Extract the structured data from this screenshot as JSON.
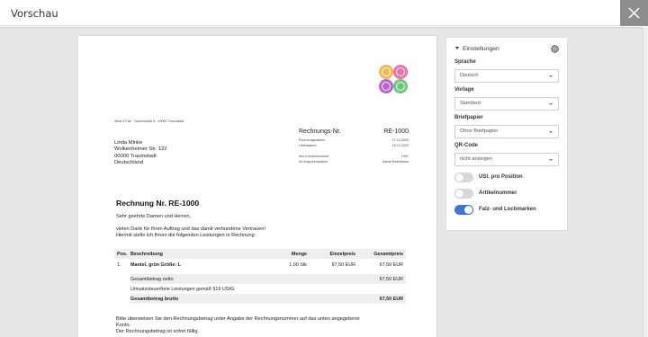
{
  "window": {
    "title": "Vorschau"
  },
  "invoice": {
    "sender_line": "Wear It Fair · Traumstraße 5 · 00000 Traumstadt",
    "recipient": [
      "Linda Minke",
      "Wolkenheimer Str. 122",
      "00000 Traumstadt",
      "Deutschland"
    ],
    "number_label": "Rechnungs-Nr.",
    "number_value": "RE-1000",
    "meta": [
      {
        "label": "Rechnungsdatum",
        "value": "17.12.2020"
      },
      {
        "label": "Lieferdatum",
        "value": "15.12.2020"
      }
    ],
    "meta2": [
      {
        "label": "Ihre Kundennummer",
        "value": "1001"
      },
      {
        "label": "Ihr Ansprechpartner",
        "value": "Daniel Beierbaum"
      }
    ],
    "heading": "Rechnung Nr. RE-1000",
    "greeting": "Sehr geehrte Damen und Herren,",
    "intro_1": "vielen Dank für Ihren Auftrag und das damit verbundene Vertrauen!",
    "intro_2": "Hiermit stelle ich Ihnen die folgenden Leistungen in Rechnung:",
    "table": {
      "headers": {
        "pos": "Pos.",
        "desc": "Beschreibung",
        "qty": "Menge",
        "unit": "Einzelpreis",
        "total": "Gesamtpreis"
      },
      "rows": [
        {
          "pos": "1.",
          "desc": "Mantel, grün Größe: L",
          "qty": "1,00 Stk",
          "unit": "67,50 EUR",
          "total": "67,50 EUR"
        }
      ],
      "net_label": "Gesamtbetrag netto",
      "net_value": "67,50 EUR",
      "vat_label": "Umsatzsteuerfreie Leistungen gemäß §19 UStG.",
      "gross_label": "Gesamtbetrag brutto",
      "gross_value": "67,50 EUR"
    },
    "closing_1": "Bitte überweisen Sie den Rechnungsbetrag unter Angabe der Rechnungsnummer auf das unten angegebene",
    "closing_2": "Konto.",
    "closing_3": "Der Rechnungsbetrag ist sofort fällig."
  },
  "settings": {
    "header": "Einstellungen",
    "sprache_label": "Sprache",
    "sprache_value": "Deutsch",
    "vorlage_label": "Vorlage",
    "vorlage_value": "Standard",
    "briefpapier_label": "Briefpapier",
    "briefpapier_value": "Ohne Briefpapier",
    "qr_label": "QR-Code",
    "qr_value": "nicht anzeigen",
    "toggles": [
      {
        "label": "USt. pro Position",
        "on": false
      },
      {
        "label": "Artikelnummer",
        "on": false
      },
      {
        "label": "Falz- und Lochmarken",
        "on": true
      }
    ],
    "accent_color": "#3a78d6"
  }
}
